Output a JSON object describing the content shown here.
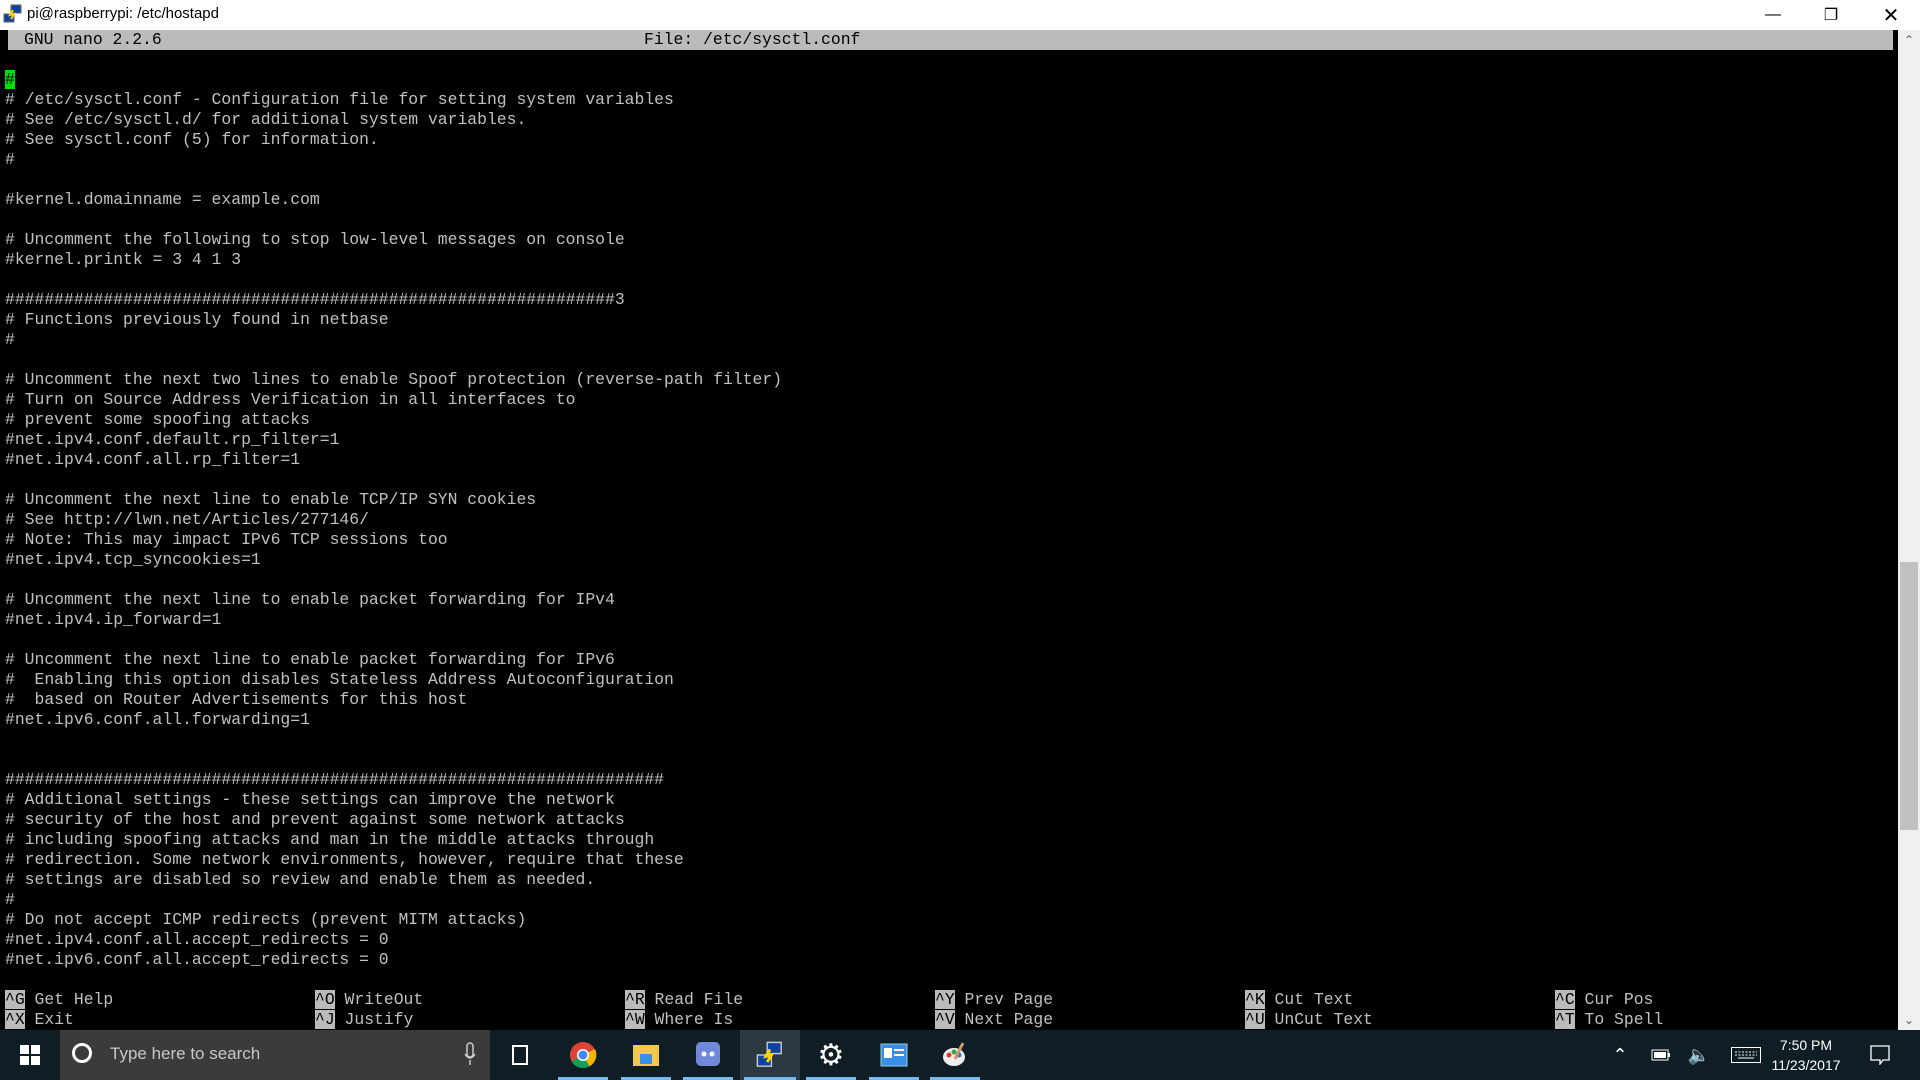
{
  "window": {
    "title": "pi@raspberrypi: /etc/hostapd"
  },
  "nano": {
    "version": "GNU nano 2.2.6",
    "file": "File: /etc/sysctl.conf",
    "cursor_char": "#",
    "lines": [
      "# /etc/sysctl.conf - Configuration file for setting system variables",
      "# See /etc/sysctl.d/ for additional system variables.",
      "# See sysctl.conf (5) for information.",
      "#",
      "",
      "#kernel.domainname = example.com",
      "",
      "# Uncomment the following to stop low-level messages on console",
      "#kernel.printk = 3 4 1 3",
      "",
      "##############################################################3",
      "# Functions previously found in netbase",
      "#",
      "",
      "# Uncomment the next two lines to enable Spoof protection (reverse-path filter)",
      "# Turn on Source Address Verification in all interfaces to",
      "# prevent some spoofing attacks",
      "#net.ipv4.conf.default.rp_filter=1",
      "#net.ipv4.conf.all.rp_filter=1",
      "",
      "# Uncomment the next line to enable TCP/IP SYN cookies",
      "# See http://lwn.net/Articles/277146/",
      "# Note: This may impact IPv6 TCP sessions too",
      "#net.ipv4.tcp_syncookies=1",
      "",
      "# Uncomment the next line to enable packet forwarding for IPv4",
      "#net.ipv4.ip_forward=1",
      "",
      "# Uncomment the next line to enable packet forwarding for IPv6",
      "#  Enabling this option disables Stateless Address Autoconfiguration",
      "#  based on Router Advertisements for this host",
      "#net.ipv6.conf.all.forwarding=1",
      "",
      "",
      "###################################################################",
      "# Additional settings - these settings can improve the network",
      "# security of the host and prevent against some network attacks",
      "# including spoofing attacks and man in the middle attacks through",
      "# redirection. Some network environments, however, require that these",
      "# settings are disabled so review and enable them as needed.",
      "#",
      "# Do not accept ICMP redirects (prevent MITM attacks)",
      "#net.ipv4.conf.all.accept_redirects = 0",
      "#net.ipv6.conf.all.accept_redirects = 0"
    ],
    "shortcuts": [
      [
        {
          "key": "^G",
          "label": "Get Help"
        },
        {
          "key": "^X",
          "label": "Exit"
        }
      ],
      [
        {
          "key": "^O",
          "label": "WriteOut"
        },
        {
          "key": "^J",
          "label": "Justify"
        }
      ],
      [
        {
          "key": "^R",
          "label": "Read File"
        },
        {
          "key": "^W",
          "label": "Where Is"
        }
      ],
      [
        {
          "key": "^Y",
          "label": "Prev Page"
        },
        {
          "key": "^V",
          "label": "Next Page"
        }
      ],
      [
        {
          "key": "^K",
          "label": "Cut Text"
        },
        {
          "key": "^U",
          "label": "UnCut Text"
        }
      ],
      [
        {
          "key": "^C",
          "label": "Cur Pos"
        },
        {
          "key": "^T",
          "label": "To Spell"
        }
      ]
    ],
    "cursor_color": "#00e000"
  },
  "scrollbar": {
    "position_percent": 74
  },
  "taskbar": {
    "search_placeholder": "Type here to search",
    "apps": [
      "task-view",
      "chrome",
      "file-explorer",
      "discord",
      "putty",
      "settings",
      "control-panel",
      "paint"
    ],
    "active_app": "putty",
    "time": "7:50 PM",
    "date": "11/23/2017"
  }
}
